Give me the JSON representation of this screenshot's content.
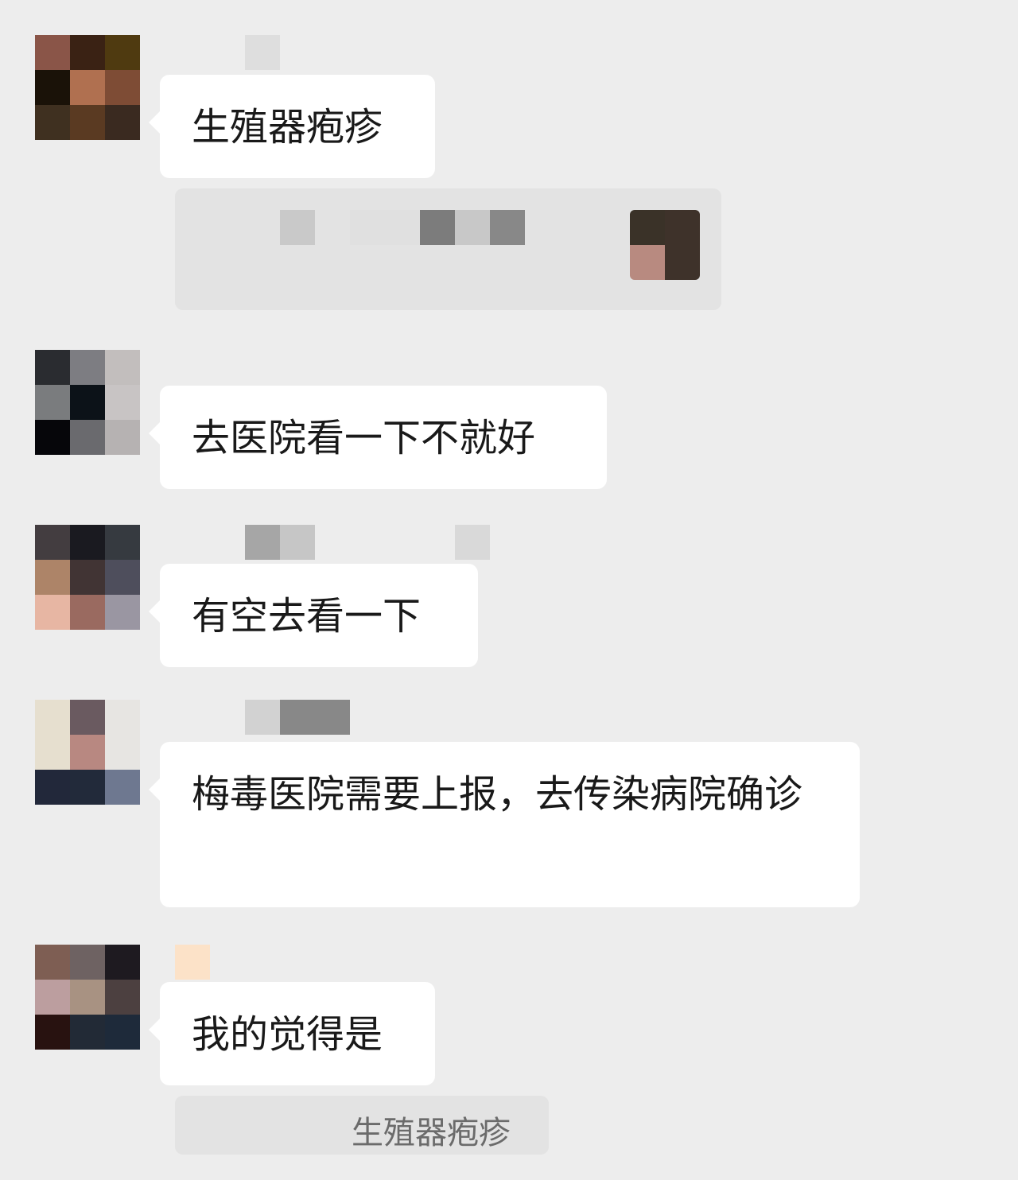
{
  "messages": [
    {
      "text": "生殖器疱疹"
    },
    {
      "text": "去医院看一下不就好"
    },
    {
      "text": "有空去看一下"
    },
    {
      "text": "梅毒医院需要上报，去传染病院确诊"
    },
    {
      "text": "我的觉得是"
    }
  ],
  "quoted_reply": {
    "text": "生殖器疱疹"
  },
  "avatars": [
    [
      "#8a5548",
      "#3a2214",
      "#4f3a10",
      "#1a1208",
      "#b07050",
      "#7e4c35",
      "#3f3020",
      "#5a3a22",
      "#3a2a20"
    ],
    [
      "#2a2c30",
      "#7d7d82",
      "#c2bebd",
      "#7a7c7e",
      "#0c1218",
      "#c8c4c4",
      "#06060a",
      "#6a6a6e",
      "#b6b2b2"
    ],
    [
      "#433d40",
      "#1a1a20",
      "#363a40",
      "#ad8468",
      "#413434",
      "#4e4e5c",
      "#e7b6a3",
      "#9a6a60",
      "#9a96a2"
    ],
    [
      "#e6dfcf",
      "#6a5a60",
      "#e7e5e2",
      "#e6dfcf",
      "#b88881",
      "#e7e5e2",
      "#22283a",
      "#222a3a",
      "#6e7890"
    ],
    [
      "#7e5e53",
      "#6e6262",
      "#1e1a20",
      "#bc9e9f",
      "#a89282",
      "#4c4040",
      "#281210",
      "#222a36",
      "#1e2a3a"
    ]
  ],
  "name_placeholders": {
    "msg1": [
      "#dedede"
    ],
    "msg3": [
      "#a6a6a6",
      "#c6c6c6"
    ],
    "msg3b": [
      "#d9d9d9"
    ],
    "msg4": [
      "#d2d2d2",
      "#888888",
      "#888888"
    ],
    "msg5": [
      "#fce2c8"
    ]
  },
  "link_card": {
    "pixels": [
      "#c9c9c9",
      "#e0e0e0",
      "#e0e0e0",
      "#7c7c7c",
      "#c8c8c8",
      "#888888"
    ],
    "thumb": [
      "#3a3228",
      "#3e322a",
      "#b88a80",
      "#3e322a"
    ]
  },
  "colors": {
    "background": "#ededed",
    "bubble": "#ffffff",
    "text": "#191919"
  }
}
